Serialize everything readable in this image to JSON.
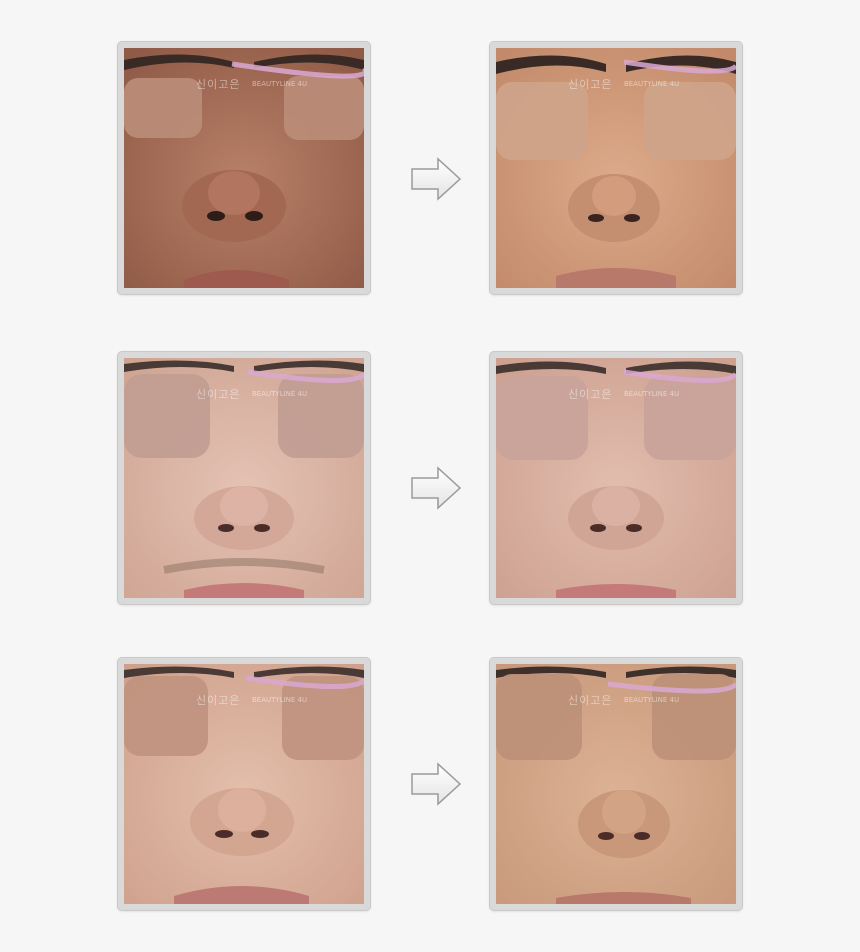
{
  "watermark": {
    "main": "신이고은",
    "sub": "BEAUTYLINE 4U"
  },
  "comparisons": [
    {
      "before": {
        "skin": "#b07a64",
        "nose": "#9b6450"
      },
      "after": {
        "skin": "#d4a080",
        "nose": "#c48e70"
      }
    },
    {
      "before": {
        "skin": "#dcb7a9",
        "nose": "#cfa595"
      },
      "after": {
        "skin": "#dcb5a6",
        "nose": "#cea291"
      }
    },
    {
      "before": {
        "skin": "#dcb4a2",
        "nose": "#cf9f8b"
      },
      "after": {
        "skin": "#d6ab8e",
        "nose": "#c9987a"
      }
    }
  ],
  "colors": {
    "background": "#f6f6f6",
    "frame": "#d9d9d9",
    "blur_patch": "#b98b76",
    "watermark_swoosh": "#d9a8d2"
  },
  "icons": {
    "arrow": "right-arrow-icon"
  }
}
